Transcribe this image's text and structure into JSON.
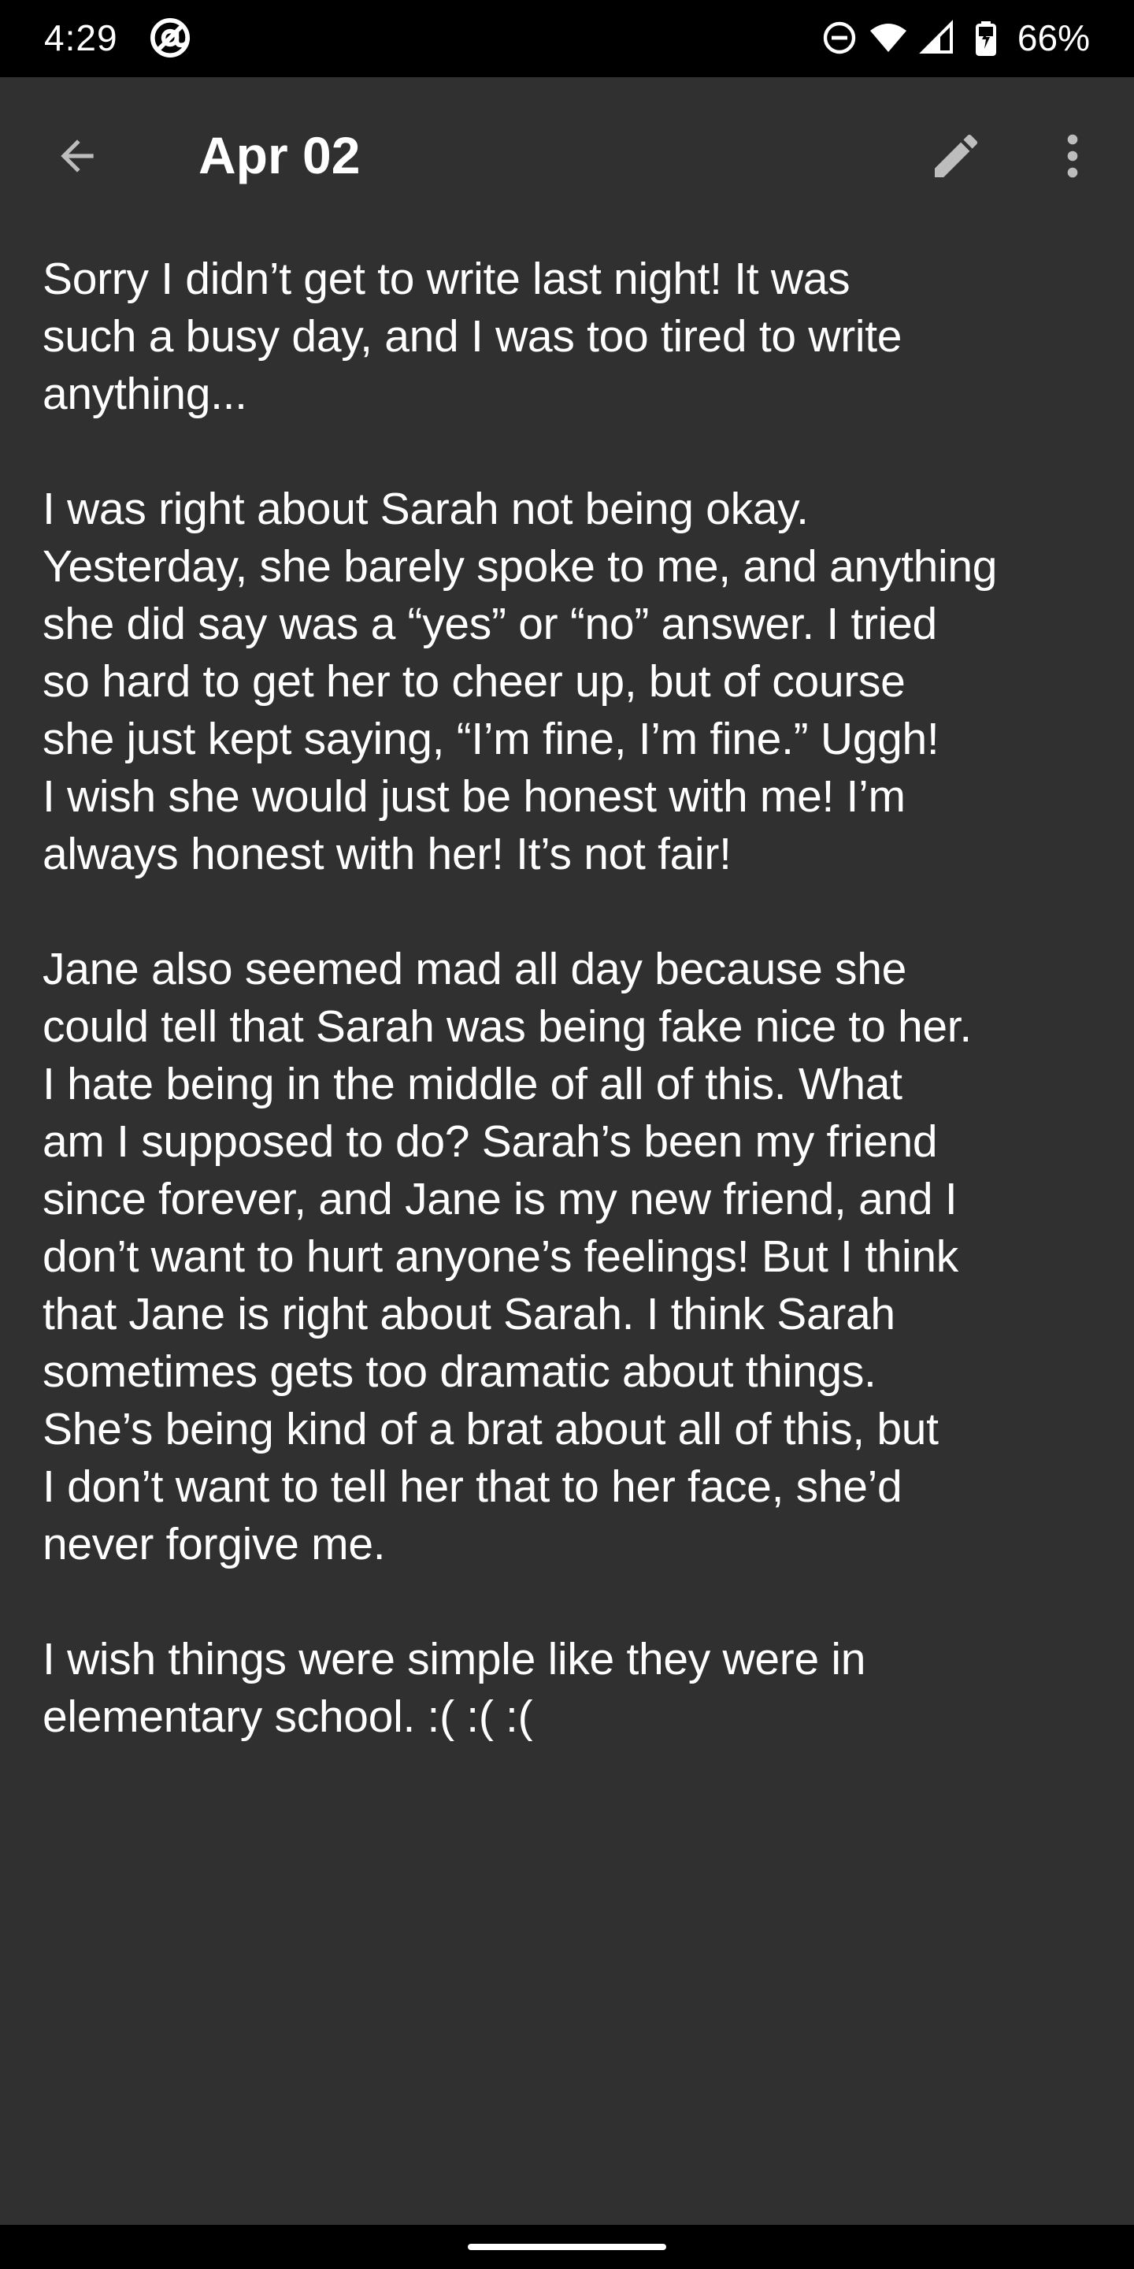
{
  "status_bar": {
    "time": "4:29",
    "battery_percent": "66%",
    "icons": [
      "at-sign-icon",
      "do-not-disturb-icon",
      "wifi-icon",
      "cell-signal-icon",
      "battery-charging-icon"
    ]
  },
  "app_bar": {
    "title": "Apr 02",
    "back_icon": "arrow-back-icon",
    "edit_icon": "pencil-icon",
    "more_icon": "more-vert-icon"
  },
  "entry": {
    "paragraphs": [
      "Sorry I didn’t get to write last night! It was\nsuch a busy day, and I was too tired to write\nanything...",
      "I was right about Sarah not being okay.\nYesterday, she barely spoke to me, and anything\nshe did say was a “yes” or “no” answer.  I tried\nso hard to get her to cheer up, but of course\nshe just kept saying, “I’m fine, I’m fine.” Uggh!\nI wish she would just be honest with me! I’m\nalways honest with her! It’s not fair!",
      "Jane also seemed mad all day because she\ncould tell that Sarah was being fake nice to her.\nI hate being in the middle of all of this. What\nam I supposed to do? Sarah’s been my friend\nsince forever, and Jane is my new friend, and I\ndon’t want to hurt anyone’s feelings! But I think\nthat Jane is right about Sarah. I think Sarah\nsometimes gets too dramatic about things.\nShe’s being kind of a brat about all of this, but\nI don’t want to tell her that to her face, she’d\nnever forgive me.",
      "I wish things were simple like they were in\nelementary school.  :( :( :("
    ]
  },
  "colors": {
    "background": "#303030",
    "status_bar": "#000000",
    "text": "#ffffff",
    "icon": "#bdbdbd"
  }
}
